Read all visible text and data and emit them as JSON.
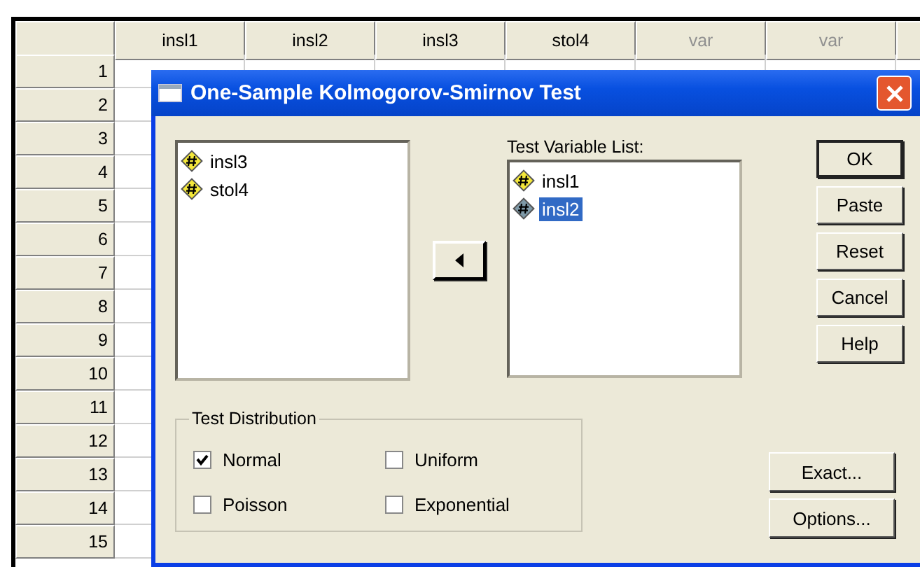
{
  "sheet": {
    "columns": [
      {
        "label": "insl1",
        "kind": "variable"
      },
      {
        "label": "insl2",
        "kind": "variable"
      },
      {
        "label": "insl3",
        "kind": "variable"
      },
      {
        "label": "stol4",
        "kind": "variable"
      },
      {
        "label": "var",
        "kind": "empty"
      },
      {
        "label": "var",
        "kind": "empty"
      }
    ],
    "rows": [
      "1",
      "2",
      "3",
      "4",
      "5",
      "6",
      "7",
      "8",
      "9",
      "10",
      "11",
      "12",
      "13",
      "14",
      "15"
    ]
  },
  "dialog": {
    "title": "One-Sample Kolmogorov-Smirnov Test",
    "source_variables": [
      {
        "name": "insl3",
        "selected": false
      },
      {
        "name": "stol4",
        "selected": false
      }
    ],
    "target_label": "Test Variable List:",
    "target_variables": [
      {
        "name": "insl1",
        "selected": false
      },
      {
        "name": "insl2",
        "selected": true
      }
    ],
    "buttons": [
      {
        "label": "OK",
        "default": true
      },
      {
        "label": "Paste",
        "default": false
      },
      {
        "label": "Reset",
        "default": false
      },
      {
        "label": "Cancel",
        "default": false
      },
      {
        "label": "Help",
        "default": false
      }
    ],
    "distribution": {
      "title": "Test Distribution",
      "options": [
        {
          "label": "Normal",
          "checked": true
        },
        {
          "label": "Uniform",
          "checked": false
        },
        {
          "label": "Poisson",
          "checked": false
        },
        {
          "label": "Exponential",
          "checked": false
        }
      ]
    },
    "extra_buttons": [
      "Exact...",
      "Options..."
    ]
  }
}
